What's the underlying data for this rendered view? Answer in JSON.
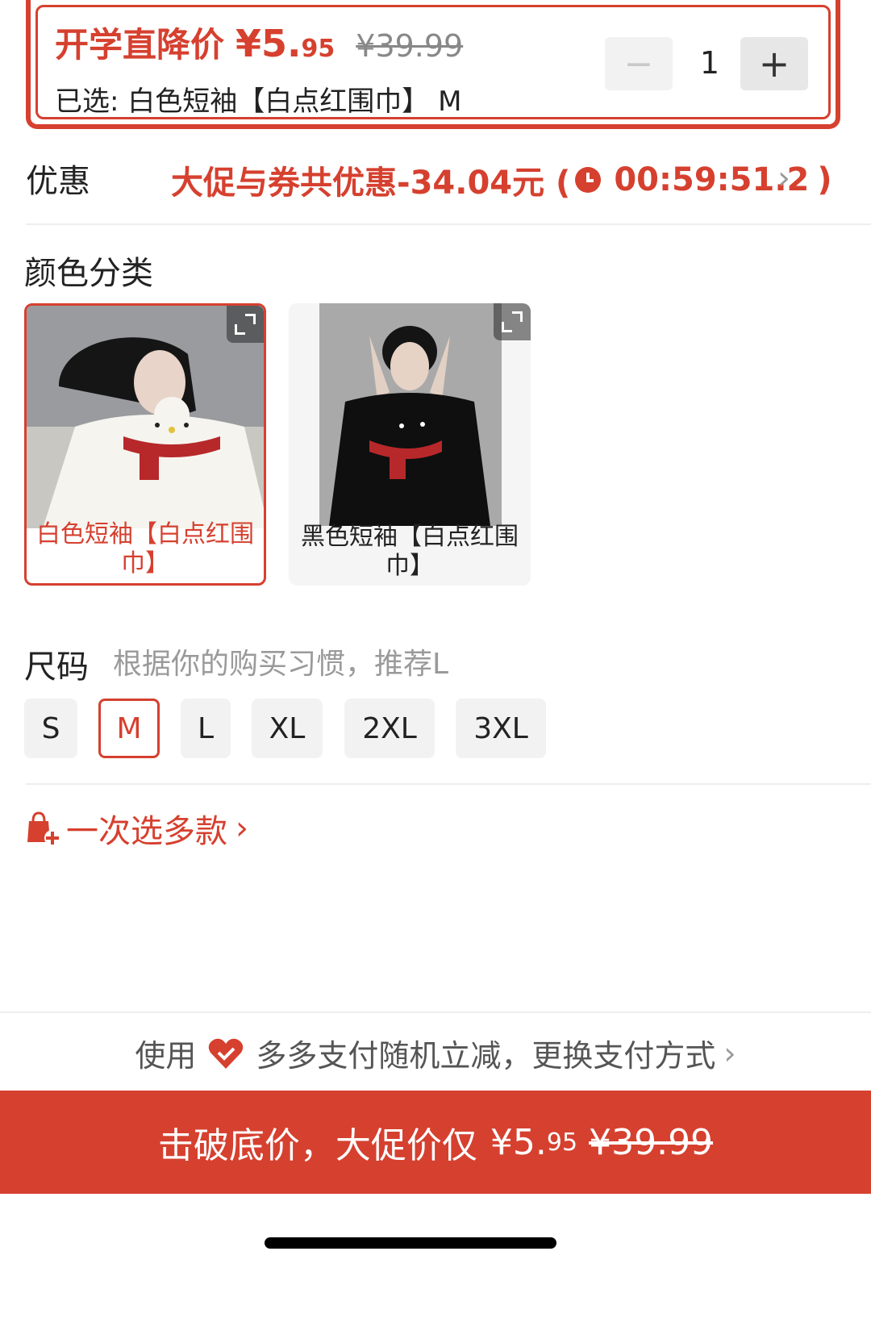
{
  "summary": {
    "promo_label": "开学直降价",
    "price_main": "¥5.",
    "price_cents": "95",
    "price_original": "¥39.99",
    "selected": "已选: 白色短袖【白点红围巾】 M",
    "qty_minus": "−",
    "qty_value": "1",
    "qty_plus": "+"
  },
  "discount": {
    "label": "优惠",
    "text": "大促与券共优惠-34.04元 (",
    "timer": "00:59:51.2",
    "close": ")",
    "chevron": "›"
  },
  "color": {
    "title": "颜色分类",
    "options": [
      {
        "label": "白色短袖【白点红围巾】",
        "selected": true
      },
      {
        "label": "黑色短袖【白点红围巾】",
        "selected": false
      }
    ]
  },
  "size": {
    "title": "尺码",
    "hint": "根据你的购买习惯，推荐L",
    "options": [
      "S",
      "M",
      "L",
      "XL",
      "2XL",
      "3XL"
    ],
    "selected": "M"
  },
  "multi_select": {
    "label": "一次选多款",
    "chevron": "›"
  },
  "payment": {
    "prefix": "使用",
    "text": "多多支付随机立减，更换支付方式",
    "chevron": "›"
  },
  "buy": {
    "label": "击破底价，大促价仅",
    "price_main": "¥5.",
    "price_cents": "95",
    "price_original": "¥39.99"
  },
  "colors": {
    "accent": "#d6402f",
    "muted": "#9a9a9a"
  },
  "icons": [
    "alarm-clock-icon",
    "expand-icon",
    "shopping-bag-plus-icon",
    "heart-check-icon",
    "chevron-right-icon"
  ]
}
